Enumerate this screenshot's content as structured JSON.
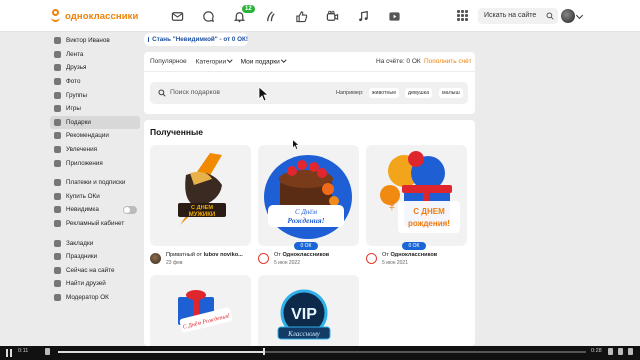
{
  "app": {
    "logo_text": "одноклассники",
    "brand_color": "#ee8208",
    "link_color": "#1a66d6"
  },
  "topnav": {
    "icons": [
      "mail-icon",
      "chat-icon",
      "bell-icon",
      "guests-icon",
      "like-icon",
      "video-icon",
      "music-icon",
      "play-icon"
    ],
    "notifications_badge": "12",
    "apps_icon": "grid-icon",
    "search_placeholder": "Искать на сайте",
    "search_icon": "search-icon"
  },
  "sidebar": {
    "groups": [
      [
        {
          "label": "Виктор Иванов",
          "icon": "user-icon"
        },
        {
          "label": "Лента",
          "icon": "feed-icon"
        },
        {
          "label": "Друзья",
          "icon": "friends-icon"
        },
        {
          "label": "Фото",
          "icon": "photo-icon"
        },
        {
          "label": "Группы",
          "icon": "groups-icon"
        },
        {
          "label": "Игры",
          "icon": "games-icon"
        },
        {
          "label": "Подарки",
          "icon": "gift-icon",
          "active": true
        },
        {
          "label": "Рекомендации",
          "icon": "recommend-icon"
        },
        {
          "label": "Увлечения",
          "icon": "hobbies-icon"
        },
        {
          "label": "Приложения",
          "icon": "apps-icon"
        }
      ],
      [
        {
          "label": "Платежи и подписки",
          "icon": "payments-icon"
        },
        {
          "label": "Купить ОКи",
          "icon": "coin-icon"
        },
        {
          "label": "Невидимка",
          "icon": "invisible-icon",
          "toggle": true,
          "toggle_on": false
        },
        {
          "label": "Рекламный кабинет",
          "icon": "ads-icon"
        }
      ],
      [
        {
          "label": "Закладки",
          "icon": "bookmark-icon"
        },
        {
          "label": "Праздники",
          "icon": "holiday-icon"
        },
        {
          "label": "Сейчас на сайте",
          "icon": "online-icon"
        },
        {
          "label": "Найти друзей",
          "icon": "find-friends-icon"
        },
        {
          "label": "Модератор ОК",
          "icon": "moderator-icon"
        }
      ]
    ]
  },
  "promo": {
    "text": "Стань \"Невидимкой\" - от 0 ОК!"
  },
  "gifts": {
    "tabs": [
      {
        "label": "Популярное",
        "dropdown": false
      },
      {
        "label": "Категории",
        "dropdown": true
      },
      {
        "label": "Мои подарки",
        "dropdown": true,
        "active": true
      }
    ],
    "balance": "На счёте: 0 ОК",
    "topup": "Пополнить счёт",
    "search_placeholder": "Поиск подарков",
    "example_label": "Например:",
    "chips": [
      "животные",
      "девушка",
      "малыш"
    ]
  },
  "received": {
    "title": "Полученные",
    "cards": [
      {
        "art": "Строительный мужик",
        "from_prefix": "Приватный от ",
        "from_name": "lubov noviko...",
        "date": "23 фев",
        "price": ""
      },
      {
        "art": "С Днем Рождения!",
        "from_prefix": "От ",
        "from_name": "Одноклассников",
        "date": "5 июн 2022",
        "price": "0 ОК"
      },
      {
        "art": "С Днем Рождения!",
        "from_prefix": "От ",
        "from_name": "Одноклассников",
        "date": "5 июн 2021",
        "price": "0 ОК"
      },
      {
        "art": "С Днём Рождения!",
        "from_prefix": "",
        "from_name": "",
        "date": "",
        "price": ""
      },
      {
        "art": "VIP Классному",
        "from_prefix": "",
        "from_name": "",
        "date": "",
        "price": ""
      }
    ]
  },
  "video": {
    "elapsed": "0:11",
    "duration": "0:28",
    "progress": 0.39
  }
}
